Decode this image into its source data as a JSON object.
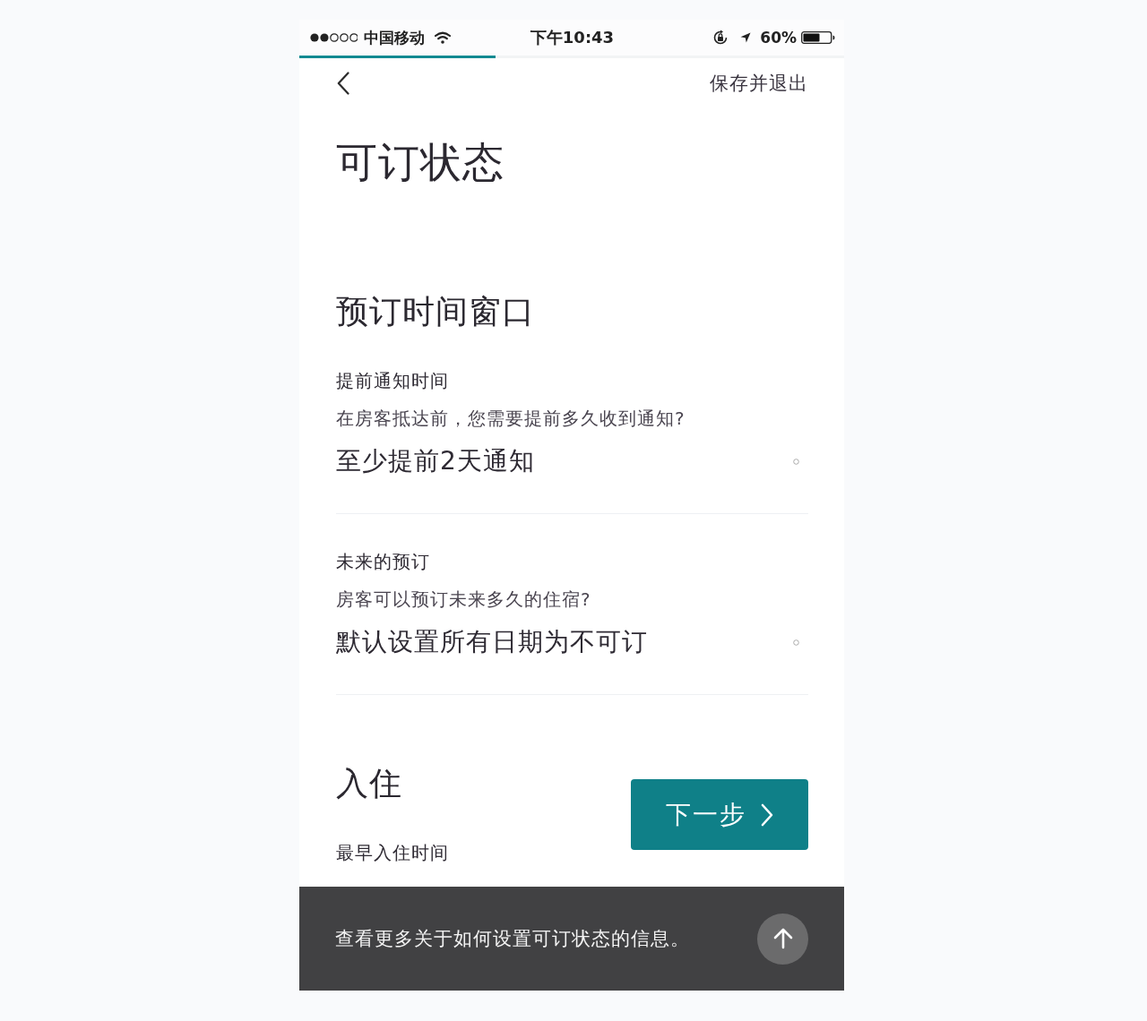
{
  "status_bar": {
    "carrier": "中国移动",
    "time": "下午10:43",
    "battery": "60%"
  },
  "progress": {
    "level": 0.36
  },
  "nav": {
    "action": "保存并退出"
  },
  "title": "可订状态",
  "sections": [
    {
      "heading": "预订时间窗口",
      "fields": [
        {
          "label": "提前通知时间",
          "question": "在房客抵达前，您需要提前多久收到通知?",
          "value": "至少提前2天通知"
        },
        {
          "label": "未来的预订",
          "question": "房客可以预订未来多久的住宿?",
          "value": "默认设置所有日期为不可订"
        }
      ]
    },
    {
      "heading": "入住",
      "fields": [
        {
          "label": "最早入住时间"
        }
      ]
    }
  ],
  "next_button": {
    "label": "下一步"
  },
  "info_bar": {
    "text": "查看更多关于如何设置可订状态的信息。"
  }
}
